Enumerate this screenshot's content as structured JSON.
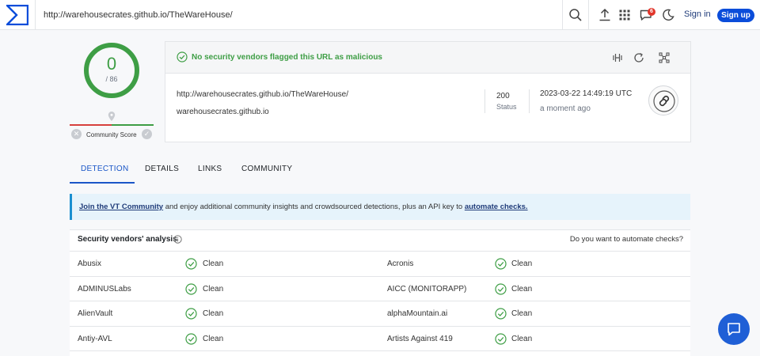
{
  "topbar": {
    "url_value": "http://warehousecrates.github.io/TheWareHouse/",
    "notifications_count": "6",
    "signin_label": "Sign in",
    "signup_label": "Sign up"
  },
  "score": {
    "detections": "0",
    "total": "/ 86",
    "community_label": "Community Score"
  },
  "summary": {
    "status_text": "No security vendors flagged this URL as malicious",
    "url": "http://warehousecrates.github.io/TheWareHouse/",
    "domain": "warehousecrates.github.io",
    "status_code": "200",
    "status_label": "Status",
    "date": "2023-03-22 14:49:19 UTC",
    "date_relative": "a moment ago"
  },
  "tabs": [
    "DETECTION",
    "DETAILS",
    "LINKS",
    "COMMUNITY"
  ],
  "banner": {
    "link1": "Join the VT Community",
    "middle": " and enjoy additional community insights and crowdsourced detections, plus an API key to ",
    "link2": "automate checks."
  },
  "vendors_table": {
    "title": "Security vendors' analysis",
    "automate_question": "Do you want to automate checks?",
    "rows": [
      {
        "left": "Abusix",
        "left_result": "Clean",
        "right": "Acronis",
        "right_result": "Clean"
      },
      {
        "left": "ADMINUSLabs",
        "left_result": "Clean",
        "right": "AICC (MONITORAPP)",
        "right_result": "Clean"
      },
      {
        "left": "AlienVault",
        "left_result": "Clean",
        "right": "alphaMountain.ai",
        "right_result": "Clean"
      },
      {
        "left": "Antiy-AVL",
        "left_result": "Clean",
        "right": "Artists Against 419",
        "right_result": "Clean"
      }
    ]
  },
  "colors": {
    "clean_green": "#3e9e45",
    "brand_blue": "#0b4dda",
    "malicious_red": "#d7403d"
  }
}
